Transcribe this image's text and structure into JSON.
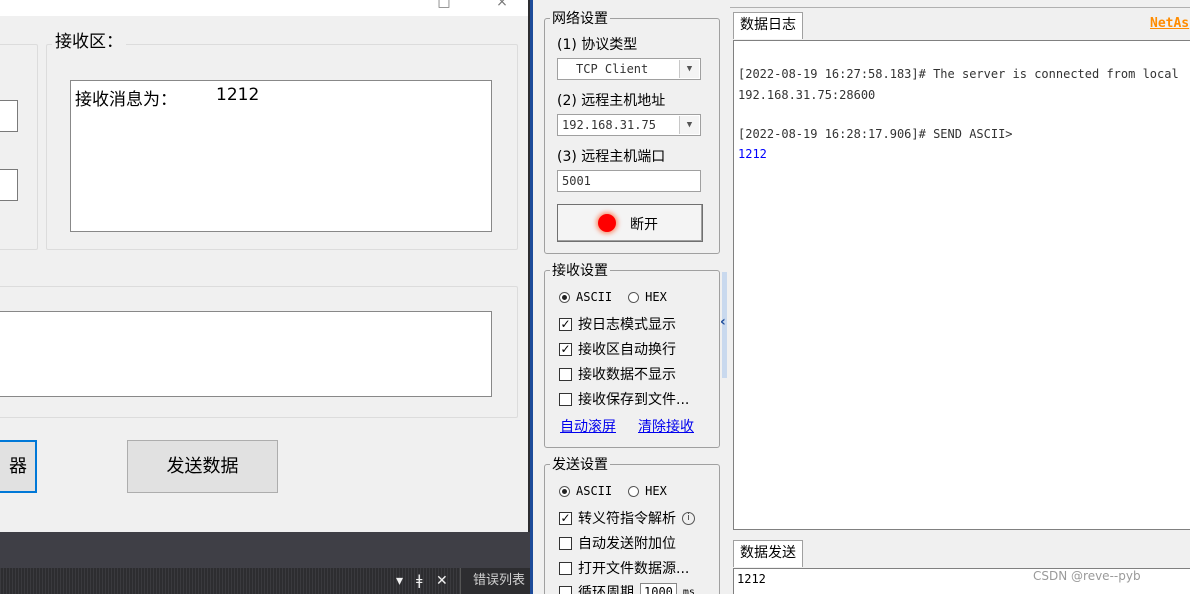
{
  "left_window": {
    "receive_group_title": "接收区：",
    "received_label": "接收消息为：",
    "received_value": "1212",
    "partial_button_label": "器",
    "send_button_label": "发送数据"
  },
  "vs": {
    "dropdown_glyph": "▾",
    "pin_glyph": "ǂ",
    "close_glyph": "✕",
    "tab_label": "错误列表"
  },
  "right_window": {
    "network": {
      "title": "网络设置",
      "protocol_label": "(1) 协议类型",
      "protocol_value": "TCP Client",
      "host_label": "(2) 远程主机地址",
      "host_value": "192.168.31.75",
      "port_label": "(3) 远程主机端口",
      "port_value": "5001",
      "disconnect_label": "断开"
    },
    "receive": {
      "title": "接收设置",
      "ascii": "ASCII",
      "hex": "HEX",
      "options": [
        "按日志模式显示",
        "接收区自动换行",
        "接收数据不显示",
        "接收保存到文件..."
      ],
      "auto_scroll": "自动滚屏",
      "clear_receive": "清除接收"
    },
    "send": {
      "title": "发送设置",
      "ascii": "ASCII",
      "hex": "HEX",
      "options": [
        "转义符指令解析",
        "自动发送附加位",
        "打开文件数据源...",
        "循环周期"
      ],
      "cycle_value": "1000",
      "cycle_unit": "ms"
    },
    "log": {
      "tab_label": "数据日志",
      "brand": "NetAs",
      "entry1_header": "[2022-08-19 16:27:58.183]# The server is connected from local",
      "entry1_body": "192.168.31.75:28600",
      "entry2_header": "[2022-08-19 16:28:17.906]# SEND ASCII>",
      "entry2_body": "1212"
    },
    "send_panel": {
      "tab_label": "数据发送",
      "value": "1212"
    },
    "watermark": "CSDN @reve--pyb"
  },
  "colors": {
    "accent_blue": "#1e4c9a",
    "link_blue": "#0000ee",
    "log_blue": "#0000ff",
    "brand_orange": "#ff8c00",
    "led_red": "#ff0000"
  }
}
